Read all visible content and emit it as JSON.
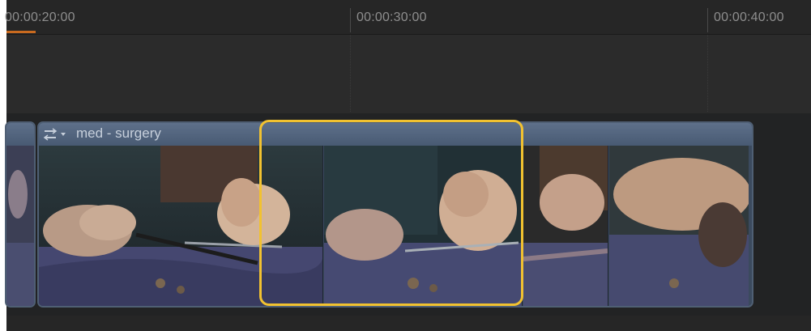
{
  "ruler": {
    "timecodes": [
      "00:00:20:00",
      "00:00:30:00",
      "00:00:40:00"
    ]
  },
  "clip": {
    "title": "med - surgery",
    "menu_icon": "clip-options-icon"
  },
  "colors": {
    "selection": "#f2c230",
    "playhead": "#c96a1f",
    "clip_header": "#5e708a"
  }
}
